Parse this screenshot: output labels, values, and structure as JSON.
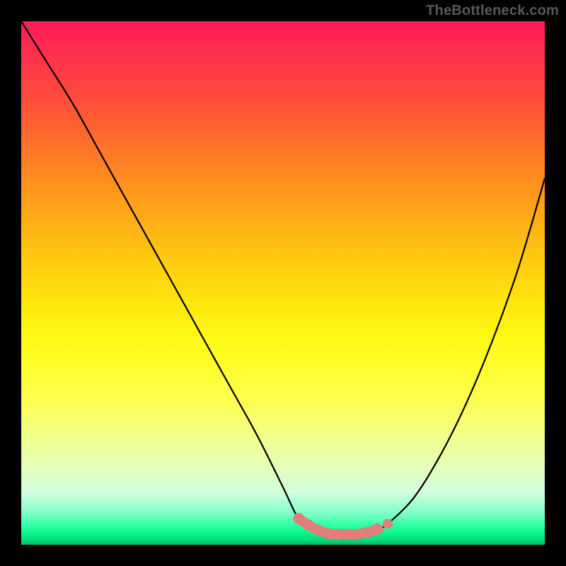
{
  "watermark": "TheBottleneck.com",
  "chart_data": {
    "type": "line",
    "title": "",
    "xlabel": "",
    "ylabel": "",
    "xlim": [
      0,
      100
    ],
    "ylim": [
      0,
      100
    ],
    "grid": false,
    "series": [
      {
        "name": "curve",
        "color": "#000000",
        "x": [
          0,
          5,
          10,
          15,
          20,
          25,
          30,
          35,
          40,
          45,
          50,
          53,
          56,
          59,
          62,
          65,
          68,
          70,
          75,
          80,
          85,
          90,
          95,
          100
        ],
        "values": [
          100,
          92,
          84,
          75,
          66,
          57,
          48,
          39,
          30,
          21,
          11,
          5,
          3,
          2,
          2,
          2,
          3,
          4,
          9,
          17,
          27,
          39,
          53,
          70
        ]
      }
    ],
    "annotations": [
      {
        "type": "segmented-points",
        "color": "#e27f7a",
        "x_from": 53,
        "x_to": 68,
        "count": 9
      },
      {
        "type": "point",
        "color": "#e27f7a",
        "x": 70,
        "y": 4
      }
    ]
  }
}
